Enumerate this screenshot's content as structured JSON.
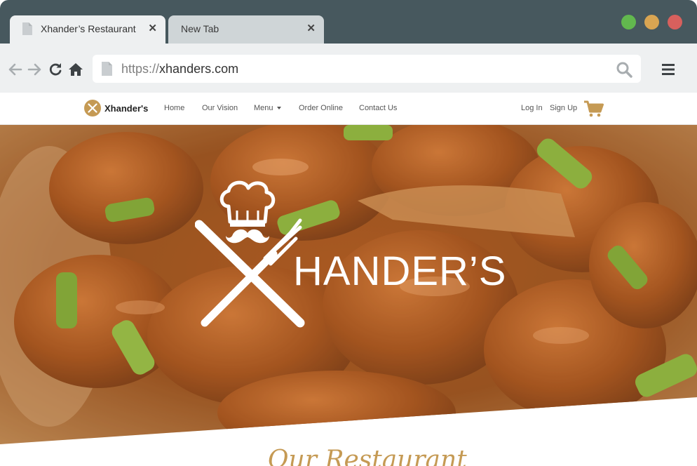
{
  "browser": {
    "tabs": [
      {
        "title": "Xhander’s Restaurant",
        "active": true
      },
      {
        "title": "New Tab",
        "active": false
      }
    ],
    "close_glyph": "✕",
    "url_protocol": "https://",
    "url_host": "xhanders.com",
    "window_buttons": [
      "#62b84e",
      "#d9a552",
      "#d7605d"
    ],
    "icons": [
      "back-icon",
      "forward-icon",
      "reload-icon",
      "home-icon",
      "search-icon",
      "menu-icon"
    ]
  },
  "site": {
    "brand": "Xhander's",
    "nav": {
      "home": "Home",
      "vision": "Our Vision",
      "menu": "Menu",
      "order": "Order Online",
      "contact": "Contact Us",
      "login": "Log In",
      "signup": "Sign Up"
    },
    "hero_title": "HANDER’S",
    "section_title": "Our Restaurant",
    "accent": "#c59a54"
  }
}
